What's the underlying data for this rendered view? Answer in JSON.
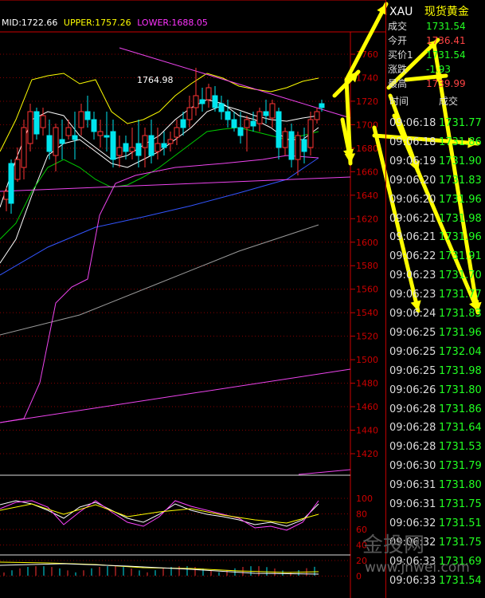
{
  "indicator": {
    "mid_label": "MID:1722.66",
    "upper_label": "UPPER:1757.26",
    "lower_label": "LOWER:1688.05",
    "colors": {
      "mid": "#ffffff",
      "upper": "#ffff00",
      "lower": "#ff33ff"
    }
  },
  "chart": {
    "peak_annotation": "1764.98",
    "y_axis_ticks": [
      "1760",
      "1740",
      "1720",
      "1700",
      "1680",
      "1660",
      "1640",
      "1620",
      "1600",
      "1580",
      "1560",
      "1540",
      "1520",
      "1500",
      "1480",
      "1460",
      "1440",
      "1420"
    ],
    "osc_ticks": [
      "100",
      "80",
      "60",
      "40",
      "20",
      "0"
    ],
    "colors": {
      "axis": "#cc0000",
      "up_candle": "#ff3333",
      "down_candle": "#00e5ee",
      "ma_fast": "#ffffff",
      "ma_mid": "#ffff00",
      "ma_slow": "#00cc00",
      "ma_long": "#3355ff",
      "ma_longer": "#999999",
      "trend": "#ee44ee",
      "arrow": "#ffff00"
    }
  },
  "quote": {
    "symbol": "XAU",
    "name": "现货黄金",
    "rows": [
      {
        "label": "成交",
        "value": "1731.54",
        "color": "#2f2"
      },
      {
        "label": "今开",
        "value": "1736.41",
        "color": "#ff4444"
      },
      {
        "label": "买价1",
        "value": "1731.54",
        "color": "#2f2"
      },
      {
        "label": "涨跌",
        "value": "-1.93",
        "color": "#2f2"
      },
      {
        "label": "最高",
        "value": "1739.99",
        "color": "#ff4444"
      }
    ],
    "ticks_header_time": "时间",
    "ticks_header_price": "成交",
    "ticks": [
      {
        "time": "09:06:18",
        "price": "1731.77"
      },
      {
        "time": "09:06:18",
        "price": "1731.86"
      },
      {
        "time": "09:06:19",
        "price": "1731.90"
      },
      {
        "time": "09:06:20",
        "price": "1731.83"
      },
      {
        "time": "09:06:20",
        "price": "1731.96"
      },
      {
        "time": "09:06:21",
        "price": "1731.98"
      },
      {
        "time": "09:06:21",
        "price": "1731.96"
      },
      {
        "time": "09:06:22",
        "price": "1731.91"
      },
      {
        "time": "09:06:23",
        "price": "1731.70"
      },
      {
        "time": "09:06:23",
        "price": "1731.77"
      },
      {
        "time": "09:06:24",
        "price": "1731.83"
      },
      {
        "time": "09:06:25",
        "price": "1731.96"
      },
      {
        "time": "09:06:25",
        "price": "1732.04"
      },
      {
        "time": "09:06:25",
        "price": "1731.98"
      },
      {
        "time": "09:06:26",
        "price": "1731.80"
      },
      {
        "time": "09:06:28",
        "price": "1731.86"
      },
      {
        "time": "09:06:28",
        "price": "1731.64"
      },
      {
        "time": "09:06:28",
        "price": "1731.53"
      },
      {
        "time": "09:06:30",
        "price": "1731.79"
      },
      {
        "time": "09:06:31",
        "price": "1731.80"
      },
      {
        "time": "09:06:31",
        "price": "1731.75"
      },
      {
        "time": "09:06:32",
        "price": "1731.51"
      },
      {
        "time": "09:06:32",
        "price": "1731.75"
      },
      {
        "time": "09:06:33",
        "price": "1731.69"
      },
      {
        "time": "09:06:33",
        "price": "1731.54"
      }
    ]
  },
  "watermark": {
    "brand": "金投网",
    "url": "www.jnwei.com"
  }
}
